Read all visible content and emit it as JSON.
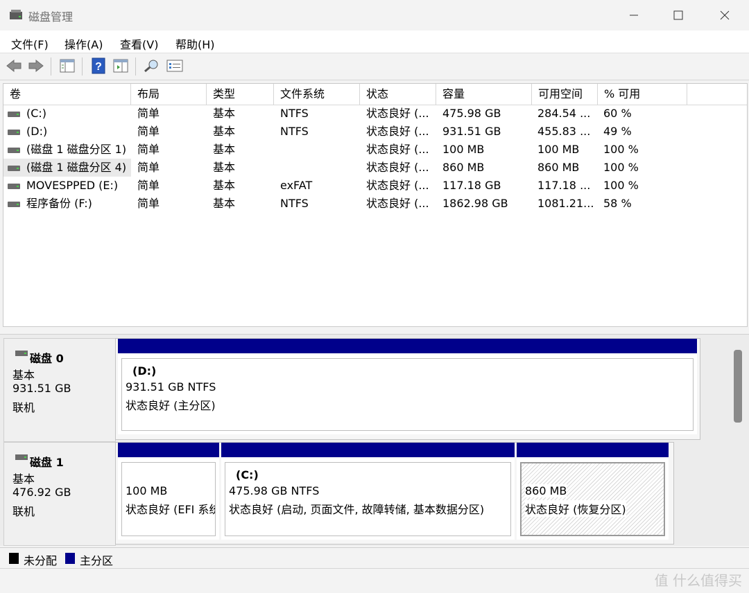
{
  "window": {
    "title": "磁盘管理"
  },
  "menu": [
    "文件(F)",
    "操作(A)",
    "查看(V)",
    "帮助(H)"
  ],
  "toolbar": [
    "back-icon",
    "forward-icon",
    "console-tree-icon",
    "help-icon",
    "properties-icon",
    "rescan-icon",
    "settings-icon"
  ],
  "columns": [
    "卷",
    "布局",
    "类型",
    "文件系统",
    "状态",
    "容量",
    "可用空间",
    "% 可用"
  ],
  "volumes": [
    {
      "vol": "(C:)",
      "layout": "简单",
      "type": "基本",
      "fs": "NTFS",
      "status": "状态良好 (...",
      "cap": "475.98 GB",
      "free": "284.54 ...",
      "pct": "60 %"
    },
    {
      "vol": "(D:)",
      "layout": "简单",
      "type": "基本",
      "fs": "NTFS",
      "status": "状态良好 (...",
      "cap": "931.51 GB",
      "free": "455.83 ...",
      "pct": "49 %"
    },
    {
      "vol": "(磁盘 1 磁盘分区 1)",
      "layout": "简单",
      "type": "基本",
      "fs": "",
      "status": "状态良好 (...",
      "cap": "100 MB",
      "free": "100 MB",
      "pct": "100 %"
    },
    {
      "vol": "(磁盘 1 磁盘分区 4)",
      "layout": "简单",
      "type": "基本",
      "fs": "",
      "status": "状态良好 (...",
      "cap": "860 MB",
      "free": "860 MB",
      "pct": "100 %"
    },
    {
      "vol": "MOVESPPED (E:)",
      "layout": "简单",
      "type": "基本",
      "fs": "exFAT",
      "status": "状态良好 (...",
      "cap": "117.18 GB",
      "free": "117.18 ...",
      "pct": "100 %"
    },
    {
      "vol": "程序备份 (F:)",
      "layout": "简单",
      "type": "基本",
      "fs": "NTFS",
      "status": "状态良好 (...",
      "cap": "1862.98 GB",
      "free": "1081.21...",
      "pct": "58 %"
    }
  ],
  "disks": [
    {
      "name": "磁盘 0",
      "type": "基本",
      "size": "931.51 GB",
      "state": "联机",
      "partitions": [
        {
          "title": "(D:)",
          "line1": "931.51 GB NTFS",
          "line2": "状态良好 (主分区)"
        }
      ]
    },
    {
      "name": "磁盘 1",
      "type": "基本",
      "size": "476.92 GB",
      "state": "联机",
      "partitions": [
        {
          "title": "",
          "line1": "100 MB",
          "line2": "状态良好 (EFI 系统"
        },
        {
          "title": "(C:)",
          "line1": "475.98 GB NTFS",
          "line2": "状态良好 (启动, 页面文件, 故障转储, 基本数据分区)"
        },
        {
          "title": "",
          "line1": "860 MB",
          "line2": "状态良好 (恢复分区)"
        }
      ]
    }
  ],
  "legend": [
    {
      "label": "未分配",
      "color": "#000000"
    },
    {
      "label": "主分区",
      "color": "#00008b"
    }
  ],
  "watermark": "值 什么值得买",
  "colors": {
    "primary_partition": "#00008b",
    "unallocated": "#000000"
  }
}
